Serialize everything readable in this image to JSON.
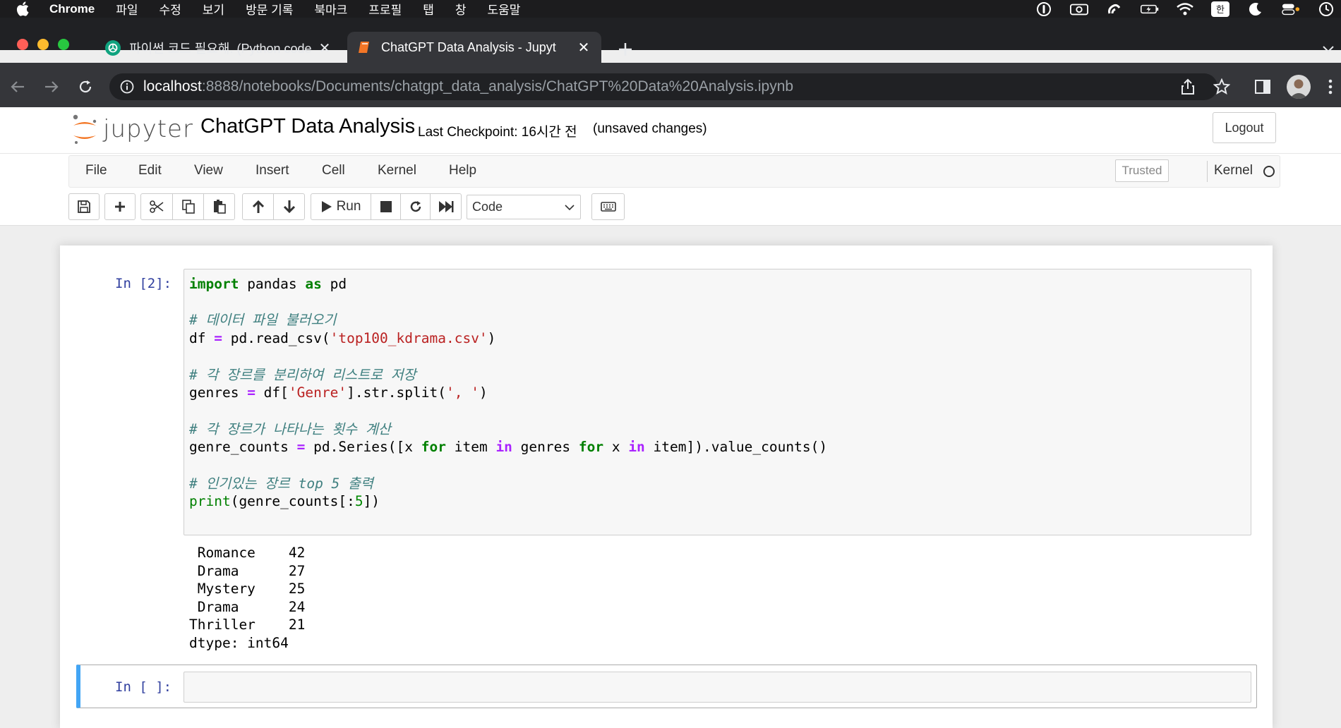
{
  "menubar": {
    "app_name": "Chrome",
    "items": [
      "파일",
      "수정",
      "보기",
      "방문 기록",
      "북마크",
      "프로필",
      "탭",
      "창",
      "도움말"
    ]
  },
  "tabs": [
    {
      "title": "파이썬 코드 필요해. (Python code",
      "active": false
    },
    {
      "title": "ChatGPT Data Analysis - Jupyt",
      "active": true
    }
  ],
  "address": {
    "host": "localhost",
    "rest": ":8888/notebooks/Documents/chatgpt_data_analysis/ChatGPT%20Data%20Analysis.ipynb"
  },
  "jupyter": {
    "logo_text": "jupyter",
    "notebook_title": "ChatGPT Data Analysis",
    "checkpoint": "Last Checkpoint: 16시간 전",
    "unsaved": "(unsaved changes)",
    "logout": "Logout",
    "menus": [
      "File",
      "Edit",
      "View",
      "Insert",
      "Cell",
      "Kernel",
      "Help"
    ],
    "trusted": "Trusted",
    "kernel": "Kernel",
    "run_label": "Run",
    "cell_type": "Code"
  },
  "cells": [
    {
      "prompt": "In [2]:",
      "code": [
        "import pandas as pd",
        "",
        "# 데이터 파일 불러오기",
        "df = pd.read_csv('top100_kdrama.csv')",
        "",
        "# 각 장르를 분리하여 리스트로 저장",
        "genres = df['Genre'].str.split(', ')",
        "",
        "# 각 장르가 나타나는 횟수 계산",
        "genre_counts = pd.Series([x for item in genres for x in item]).value_counts()",
        "",
        "# 인기있는 장르 top 5 출력",
        "print(genre_counts[:5])"
      ],
      "output": [
        " Romance    42",
        " Drama      27",
        " Mystery    25",
        " Drama      24",
        "Thriller    21",
        "dtype: int64"
      ]
    },
    {
      "prompt": "In [ ]:",
      "code": [],
      "output": []
    }
  ],
  "colors": {
    "prompt_in": "#303f9f",
    "selected_cell": "#42a5f5",
    "keyword": "#008000",
    "string": "#ba2121",
    "comment": "#408080"
  }
}
